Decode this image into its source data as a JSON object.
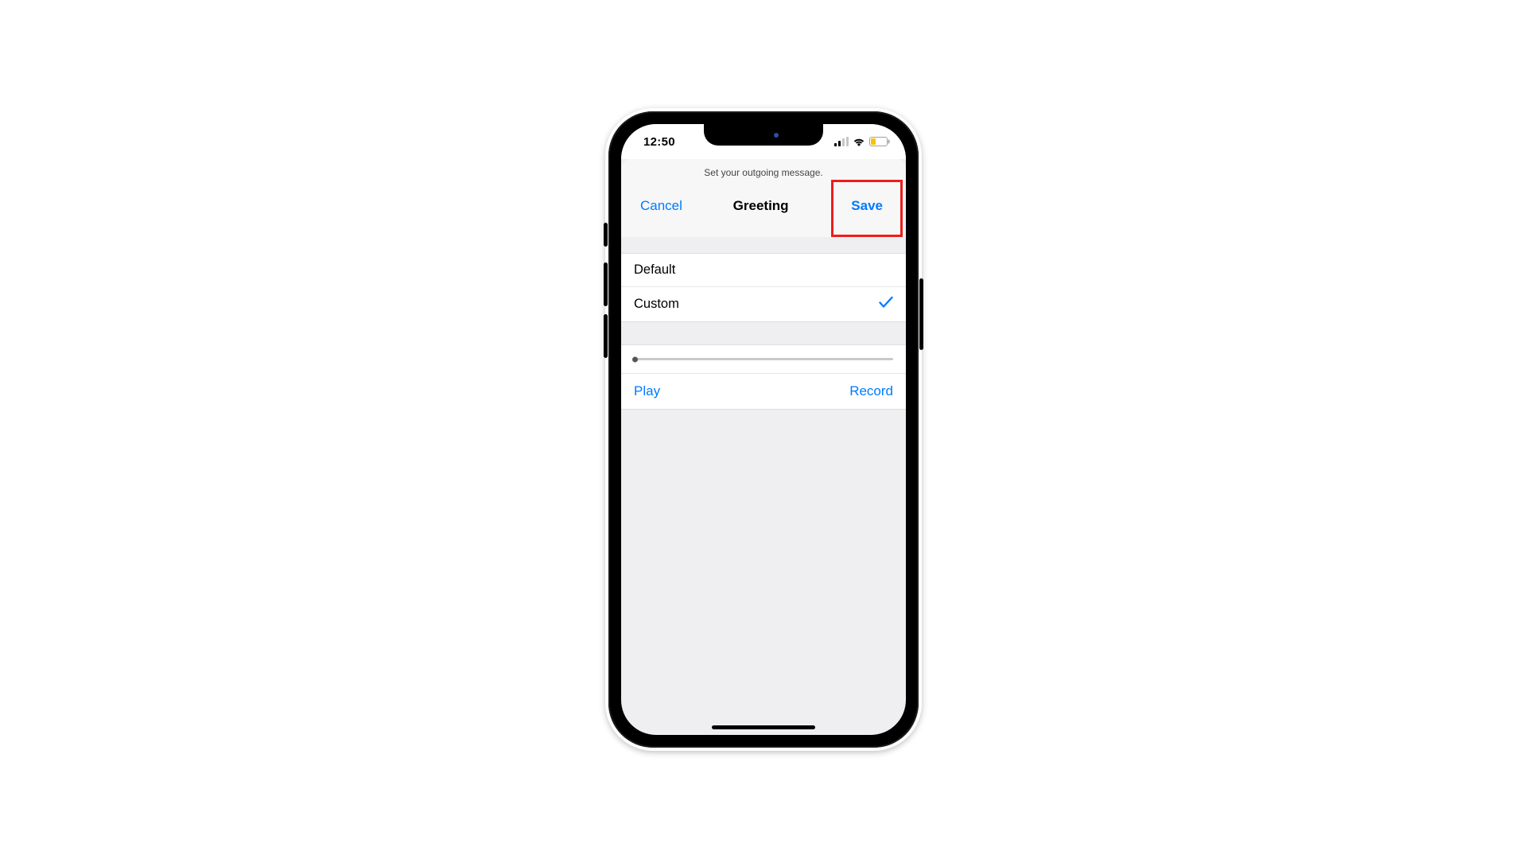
{
  "status": {
    "time": "12:50"
  },
  "header": {
    "subtitle": "Set your outgoing message.",
    "cancel_label": "Cancel",
    "title": "Greeting",
    "save_label": "Save"
  },
  "options": [
    {
      "label": "Default",
      "selected": false
    },
    {
      "label": "Custom",
      "selected": true
    }
  ],
  "playback": {
    "play_label": "Play",
    "record_label": "Record"
  },
  "colors": {
    "accent": "#007aff",
    "highlight_box": "#ef1c1c"
  }
}
